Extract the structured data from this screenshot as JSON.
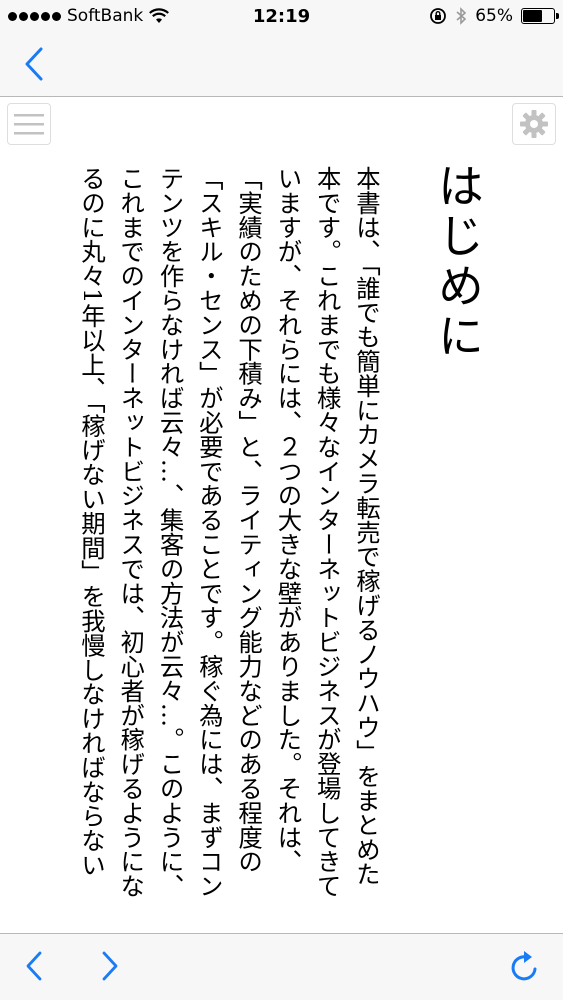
{
  "status_bar": {
    "carrier": "SoftBank",
    "time": "12:19",
    "battery_percent_label": "65%",
    "battery_level": 0.65,
    "icons": [
      "signal-dots-icon",
      "wifi-icon",
      "rotation-lock-icon",
      "bluetooth-icon",
      "battery-icon"
    ]
  },
  "nav": {
    "back_icon": "chevron-left-icon"
  },
  "reader": {
    "menu_icon": "hamburger-menu-icon",
    "settings_icon": "gear-icon",
    "chapter_title": "はじめに",
    "body_text": "本書は、「誰でも簡単にカメラ転売で稼げるノウハウ」をまとめた本です。これまでも様々なインターネットビジネスが登場してきていますが、それらには、２つの大きな壁がありました。それは、「実績のための下積み」と、ライティング能力などのある程度の「スキル・センス」が必要であることです。稼ぐ為には、まずコンテンツを作らなければ云々…、集客の方法が云々…。このように、これまでのインターネットビジネスでは、初心者が稼げるようになるのに丸々1年以上、「稼げない期間」を我慢しなければならない"
  },
  "toolbar": {
    "prev_icon": "chevron-left-icon",
    "next_icon": "chevron-right-icon",
    "refresh_icon": "refresh-icon"
  },
  "colors": {
    "accent": "#1a7cf5",
    "bar_background": "#f7f7f7",
    "icon_gray": "#c2c2c2"
  }
}
